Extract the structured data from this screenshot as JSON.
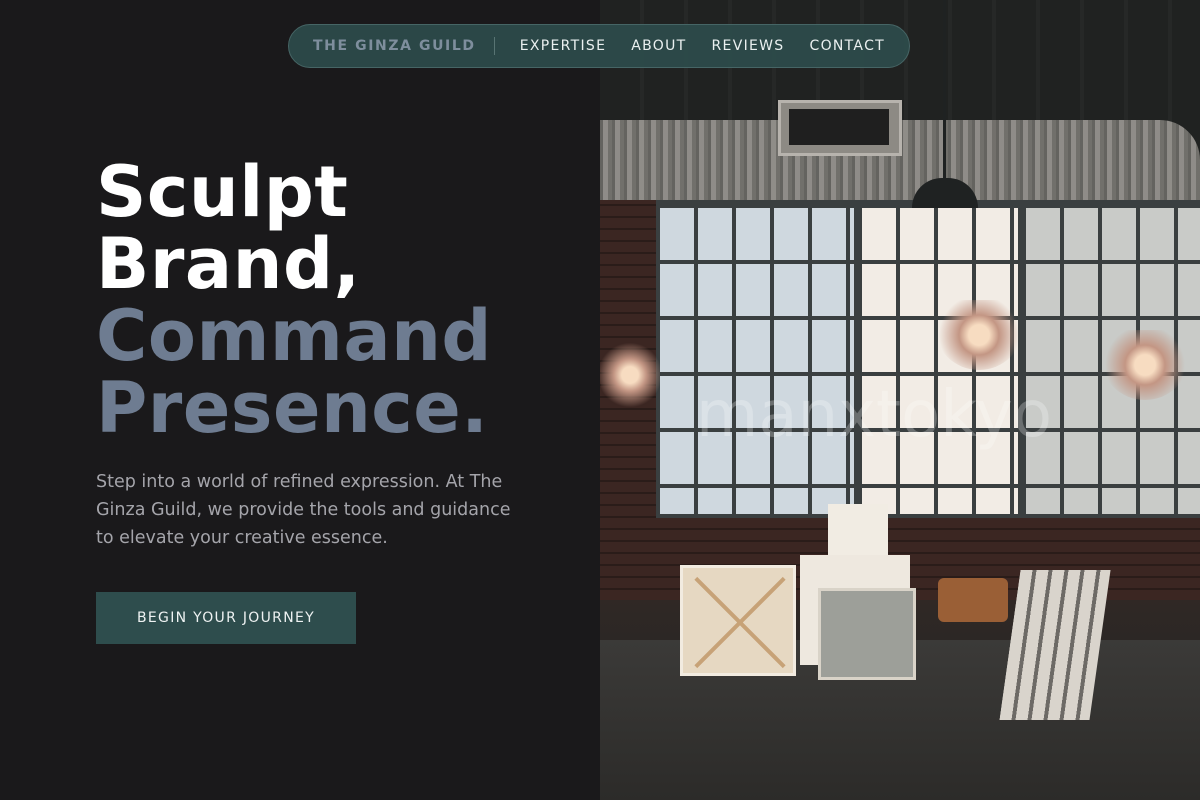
{
  "nav": {
    "brand": "THE GINZA GUILD",
    "links": [
      "EXPERTISE",
      "ABOUT",
      "REVIEWS",
      "CONTACT"
    ]
  },
  "hero": {
    "headline_line1": "Sculpt",
    "headline_line2": "Brand,",
    "headline_line3": "Command",
    "headline_line4": "Presence.",
    "intro": "Step into a world of refined expression. At The Ginza Guild, we provide the tools and guidance to elevate your creative essence.",
    "cta_label": "BEGIN YOUR JOURNEY"
  },
  "image": {
    "watermark": "manxtokyo"
  },
  "colors": {
    "background": "#1a191b",
    "accent_teal": "#2e4d4d",
    "headline_white": "#ffffff",
    "headline_slate": "#6e7c91",
    "body_text": "#a4a4aa"
  }
}
